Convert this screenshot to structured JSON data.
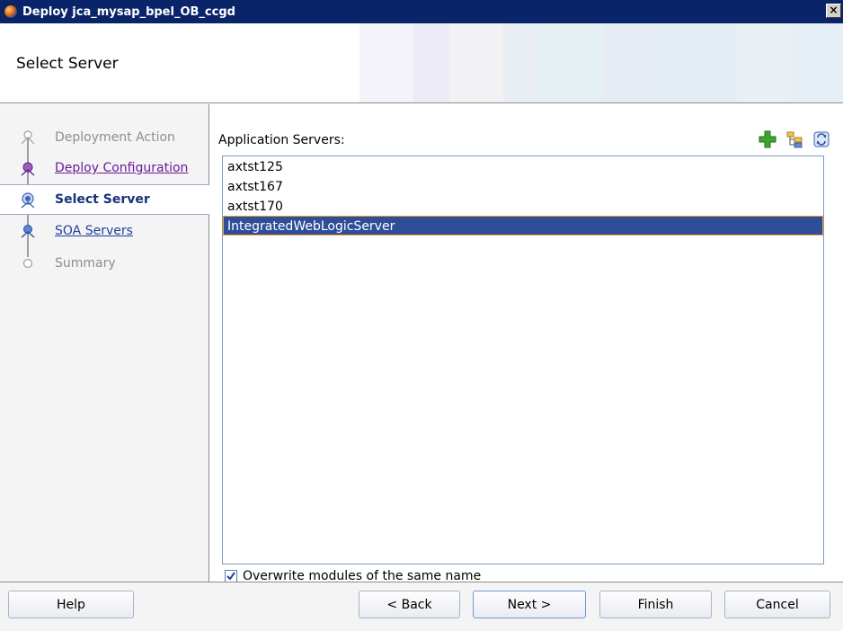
{
  "window": {
    "title": "Deploy jca_mysap_bpel_OB_ccgd",
    "close_label": "×"
  },
  "header": {
    "title": "Select Server"
  },
  "nav": {
    "items": [
      {
        "label": "Deployment Action",
        "state": "disabled"
      },
      {
        "label": "Deploy Configuration",
        "state": "visited"
      },
      {
        "label": "Select Server",
        "state": "active"
      },
      {
        "label": "SOA Servers",
        "state": "link"
      },
      {
        "label": "Summary",
        "state": "disabled"
      }
    ]
  },
  "main": {
    "list_label": "Application Servers:",
    "toolbar_icons": [
      "add-server-icon",
      "server-tree-icon",
      "refresh-icon"
    ],
    "servers": [
      "axtst125",
      "axtst167",
      "axtst170",
      "IntegratedWebLogicServer"
    ],
    "selected_server": "IntegratedWebLogicServer",
    "overwrite_checkbox": {
      "label": "Overwrite modules of the same name",
      "checked": true
    }
  },
  "buttons": {
    "help": "Help",
    "back": "< Back",
    "next": "Next >",
    "finish": "Finish",
    "cancel": "Cancel"
  },
  "colors": {
    "titlebar": "#0a246a",
    "selection": "#2f4e98",
    "selection_border": "#f0a030",
    "active_nav": "#17327a",
    "visited_nav": "#6a1b9a"
  }
}
